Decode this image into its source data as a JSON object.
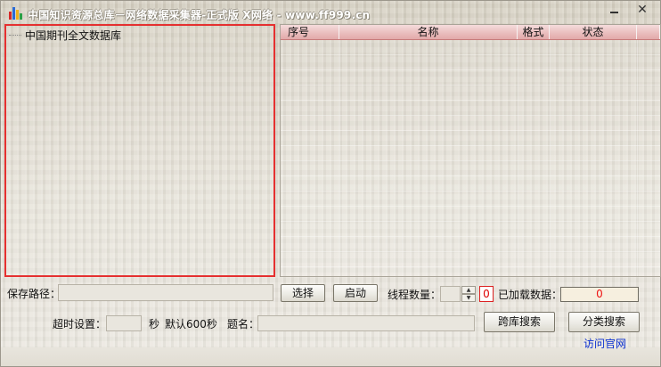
{
  "window": {
    "title": "中国知识资源总库－网络数据采集器-正式版 X网络 - www.ff999.cn",
    "minimize_symbol": "—",
    "close_symbol": "✕",
    "icon": "bar-chart-icon",
    "icon_colors": [
      "#d62a2a",
      "#2a6ad6",
      "#f0b21a",
      "#29a046"
    ]
  },
  "tree": {
    "root_label": "中国期刊全文数据库"
  },
  "list": {
    "columns": [
      "序号",
      "名称",
      "格式",
      "状态",
      ""
    ]
  },
  "controls": {
    "save_path_label": "保存路径：",
    "save_path_value": "",
    "select_button": "选择",
    "start_button": "启动",
    "thread_count_label": "线程数量：",
    "thread_count_value": "",
    "thread_count_small_value": "0",
    "loaded_label": "已加载数据：",
    "loaded_value": "0",
    "timeout_label": "超时设置：",
    "timeout_value": "",
    "seconds_label": "秒",
    "default_label": "默认600秒",
    "title_name_label": "题名：",
    "title_name_value": "",
    "cross_search_button": "跨库搜索",
    "category_search_button": "分类搜索",
    "visit_site_link": "访问官网"
  },
  "colors": {
    "selection_border": "#e53030",
    "header_gradient": "#e9bcbc",
    "loaded_text": "#e11111",
    "link": "#0a2fd0"
  }
}
